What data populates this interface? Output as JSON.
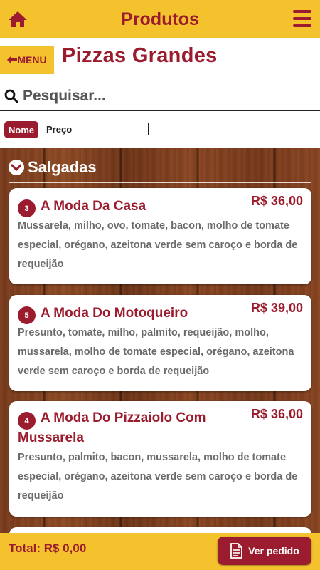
{
  "topbar": {
    "title": "Produtos",
    "home_icon": "home-icon",
    "menu_icon": "hamburger-menu-icon"
  },
  "header": {
    "back_label": "MENU",
    "back_icon": "arrow-left-icon",
    "title": "Pizzas Grandes"
  },
  "search": {
    "placeholder": "Pesquisar...",
    "icon": "search-icon"
  },
  "sort": {
    "options": [
      {
        "label": "Nome",
        "active": true
      },
      {
        "label": "Preço",
        "active": false
      }
    ]
  },
  "section": {
    "title": "Salgadas",
    "icon": "chevron-down-circle-icon"
  },
  "products": [
    {
      "number": "3",
      "name": "A Moda Da Casa",
      "price": "R$ 36,00",
      "description": "Mussarela, milho, ovo, tomate, bacon, molho de tomate especial, orégano, azeitona verde sem caroço e borda de requeijão"
    },
    {
      "number": "5",
      "name": "A Moda Do Motoqueiro",
      "price": "R$ 39,00",
      "description": "Presunto, tomate, milho, palmito, requeijão, molho, mussarela, molho de tomate especial, orégano, azeitona verde sem caroço e borda de requeijão"
    },
    {
      "number": "4",
      "name": "A Moda Do Pizzaiolo Com Mussarela",
      "price": "R$ 36,00",
      "description": "Presunto, palmito, bacon, mussarela, molho de tomate especial, orégano, azeitona verde sem caroço e borda de requeijão"
    }
  ],
  "footer": {
    "total_label": "Total: R$ 0,00",
    "order_button": "Ver pedido",
    "order_icon": "document-icon"
  },
  "colors": {
    "brand_yellow": "#f3c22d",
    "brand_red": "#9b1c2e",
    "text_gray": "#6b6b6b"
  }
}
